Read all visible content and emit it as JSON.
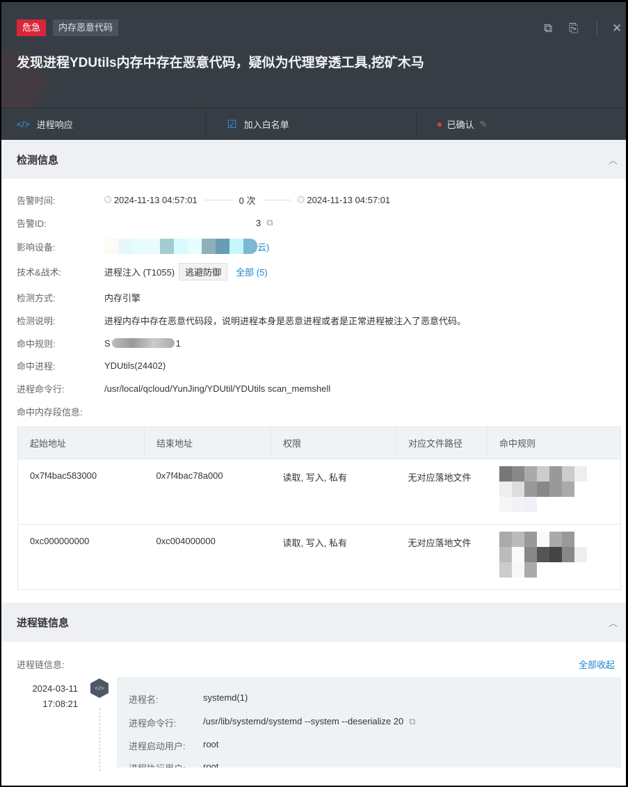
{
  "header": {
    "severity": "危急",
    "category": "内存恶意代码",
    "title": "发现进程YDUtils内存中存在恶意代码，疑似为代理穿透工具,挖矿木马",
    "icons": [
      "copy-window-icon",
      "export-icon",
      "close-icon"
    ]
  },
  "actions": [
    {
      "label": "进程响应",
      "icon": "code-icon"
    },
    {
      "label": "加入白名单",
      "icon": "whitelist-icon"
    },
    {
      "label": "已确认",
      "icon": "edit-icon"
    }
  ],
  "detect": {
    "title": "检测信息",
    "alarm_time": {
      "label": "告警时间:",
      "first": "2024-11-13 04:57:01",
      "count": "0 次",
      "last": "2024-11-13 04:57:01"
    },
    "alarm_id": {
      "label": "告警ID:",
      "value_tail": "3"
    },
    "device": {
      "label": "影响设备:",
      "value_tail": "云)"
    },
    "tactics": {
      "label": "技术&战术:",
      "technique": "进程注入 (T1055)",
      "tag": "逃避防御",
      "all": "全部 (5)"
    },
    "method": {
      "label": "检测方式:",
      "value": "内存引擎"
    },
    "desc": {
      "label": "检测说明:",
      "value": "进程内存中存在恶意代码段，说明进程本身是恶意进程或者是正常进程被注入了恶意代码。"
    },
    "rule": {
      "label": "命中规则:",
      "head": "S",
      "tail": "1"
    },
    "process": {
      "label": "命中进程:",
      "value": "YDUtils(24402)"
    },
    "cmdline": {
      "label": "进程命令行:",
      "value": "/usr/local/qcloud/YunJing/YDUtil/YDUtils scan_memshell"
    },
    "mem_label": "命中内存段信息:",
    "table": {
      "headers": [
        "起始地址",
        "结束地址",
        "权限",
        "对应文件路径",
        "命中规则"
      ],
      "rows": [
        [
          "0x7f4bac583000",
          "0x7f4bac78a000",
          "读取, 写入, 私有",
          "无对应落地文件"
        ],
        [
          "0xc000000000",
          "0xc004000000",
          "读取, 写入, 私有",
          "无对应落地文件"
        ]
      ]
    }
  },
  "chain": {
    "title": "进程链信息",
    "label": "进程链信息:",
    "collapse": "全部收起",
    "date": "2024-03-11",
    "time": "17:08:21",
    "fields": [
      {
        "label": "进程名:",
        "value": "systemd(1)"
      },
      {
        "label": "进程命令行:",
        "value": "/usr/lib/systemd/systemd --system --deserialize 20"
      },
      {
        "label": "进程启动用户:",
        "value": "root"
      },
      {
        "label": "进程执行用户:",
        "value": "root"
      }
    ]
  },
  "colors": {
    "danger": "#d9263a",
    "link": "#1a86d0",
    "header_bg": "#373d45"
  }
}
